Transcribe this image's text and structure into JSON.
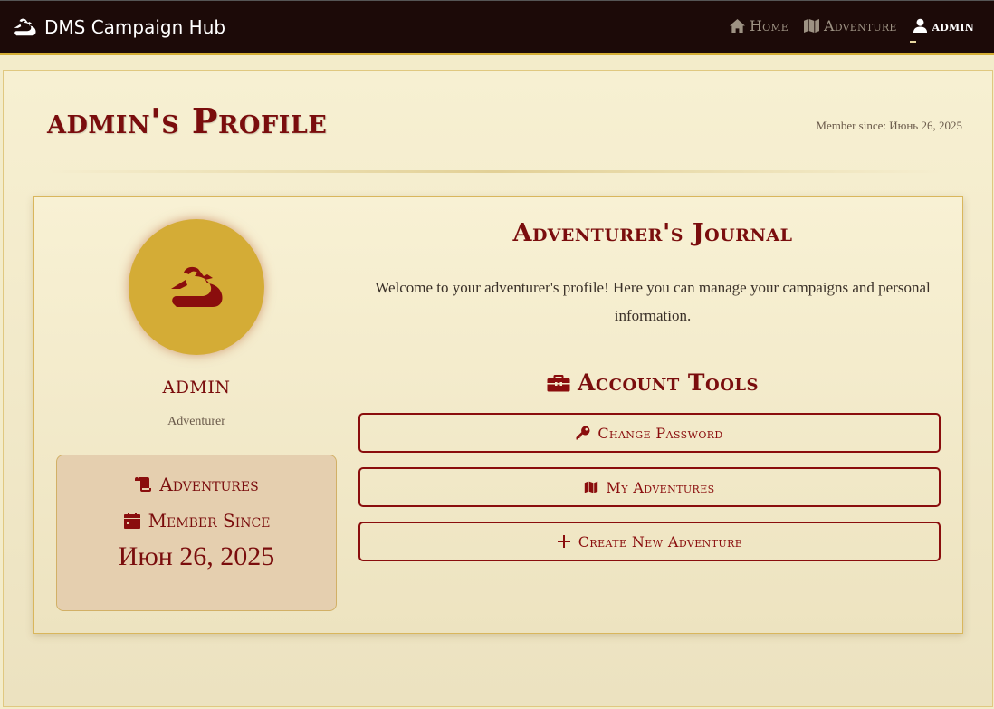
{
  "navbar": {
    "brand": "DMS Campaign Hub",
    "items": [
      {
        "label": "Home",
        "icon": "home-icon"
      },
      {
        "label": "Adventure",
        "icon": "map-icon"
      },
      {
        "label": "admin",
        "icon": "user-icon"
      }
    ]
  },
  "header": {
    "title": "admin's Profile",
    "member_since": "Member since: Июнь 26, 2025"
  },
  "profile": {
    "username": "admin",
    "role": "Adventurer",
    "stats": {
      "adventures_label": "Adventures",
      "member_since_label": "Member Since",
      "member_since_date": "Июн 26, 2025"
    }
  },
  "journal": {
    "title": "Adventurer's Journal",
    "welcome": "Welcome to your adventurer's profile! Here you can manage your campaigns and personal information."
  },
  "tools": {
    "title": "Account Tools",
    "buttons": [
      {
        "label": "Change Password",
        "icon": "key-icon"
      },
      {
        "label": "My Adventures",
        "icon": "map-icon"
      },
      {
        "label": "Create New Adventure",
        "icon": "plus-icon"
      }
    ]
  },
  "colors": {
    "navbar_bg": "#1c0a08",
    "accent_gold": "#d4ae35",
    "primary_red": "#7a0d0d",
    "page_bg": "#f3ecca"
  }
}
